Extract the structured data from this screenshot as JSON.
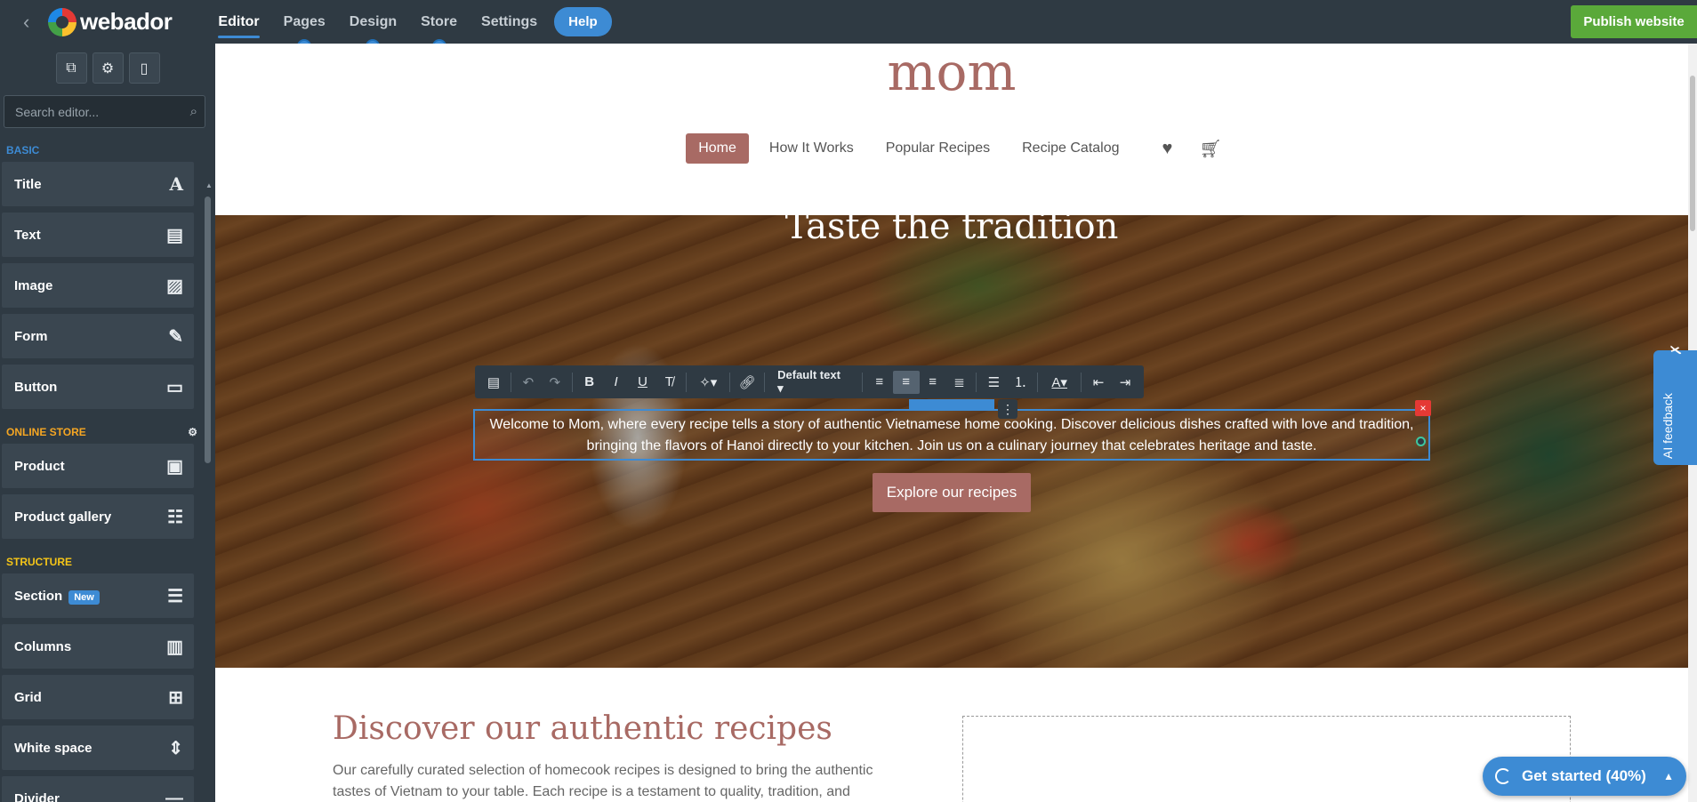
{
  "app": {
    "brand": "webador",
    "nav": [
      "Editor",
      "Pages",
      "Design",
      "Store",
      "Settings"
    ],
    "help": "Help",
    "publish": "Publish website"
  },
  "panel": {
    "search_placeholder": "Search editor...",
    "sections": {
      "basic": "BASIC",
      "online_store": "ONLINE STORE",
      "structure": "STRUCTURE"
    },
    "basic_items": [
      "Title",
      "Text",
      "Image",
      "Form",
      "Button"
    ],
    "store_items": [
      "Product",
      "Product gallery"
    ],
    "structure_items": [
      "Section",
      "Columns",
      "Grid",
      "White space",
      "Divider"
    ],
    "new_badge": "New"
  },
  "site": {
    "title": "mom",
    "nav": [
      "Home",
      "How It Works",
      "Popular Recipes",
      "Recipe Catalog"
    ],
    "hero_title": "Taste the tradition",
    "hero_text": "Welcome to Mom, where every recipe tells a story of authentic Vietnamese home cooking. Discover delicious dishes crafted with love and tradition, bringing the flavors of Hanoi directly to your kitchen. Join us on a culinary journey that celebrates heritage and taste.",
    "hero_button": "Explore our recipes",
    "section_title": "Discover our authentic recipes",
    "section_text": "Our carefully curated selection of homecook recipes is designed to bring the authentic tastes of Vietnam to your table. Each recipe is a testament to quality, tradition, and"
  },
  "toolbar": {
    "style_dropdown": "Default text"
  },
  "widgets": {
    "ai_feedback": "AI feedback",
    "get_started": "Get started (40%)"
  },
  "colors": {
    "accent": "#3d8bd4",
    "brand_rose": "#a86a64",
    "publish_green": "#5aa93a",
    "panel_bg": "#2f3a43"
  }
}
